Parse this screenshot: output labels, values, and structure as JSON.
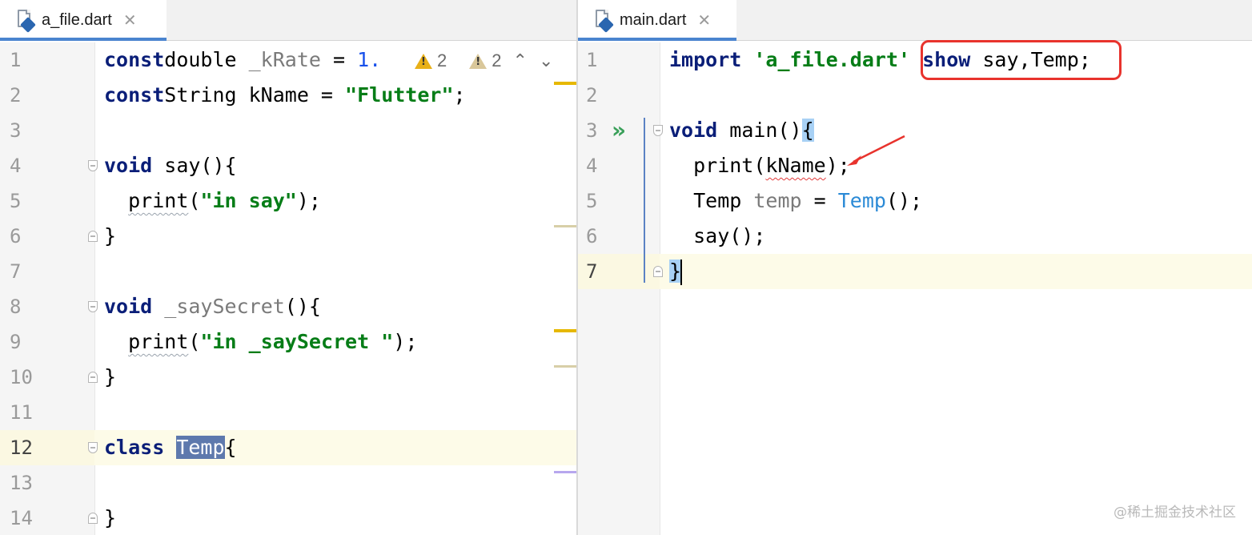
{
  "left_pane": {
    "tab_label": "a_file.dart",
    "tab_close": "✕",
    "lines": [
      {
        "n": "1",
        "t": [
          [
            "kw",
            "const"
          ],
          [
            "",
            "double "
          ],
          [
            "gray",
            "_kRate"
          ],
          [
            "",
            " = "
          ],
          [
            "num",
            "1."
          ]
        ]
      },
      {
        "n": "2",
        "t": [
          [
            "kw",
            "const"
          ],
          [
            "",
            "String kName = "
          ],
          [
            "str",
            "\"Flutter\""
          ],
          [
            "",
            ";"
          ]
        ]
      },
      {
        "n": "3",
        "t": []
      },
      {
        "n": "4",
        "t": [
          [
            "kw",
            "void"
          ],
          [
            "",
            " say(){"
          ]
        ]
      },
      {
        "n": "5",
        "t": [
          [
            "",
            "  "
          ],
          [
            "squig",
            "print"
          ],
          [
            "",
            "("
          ],
          [
            "str",
            "\"in say\""
          ],
          [
            "",
            ");"
          ]
        ]
      },
      {
        "n": "6",
        "t": [
          [
            "",
            "}"
          ]
        ]
      },
      {
        "n": "7",
        "t": []
      },
      {
        "n": "8",
        "t": [
          [
            "kw",
            "void"
          ],
          [
            "",
            " "
          ],
          [
            "gray",
            "_saySecret"
          ],
          [
            "",
            "(){"
          ]
        ]
      },
      {
        "n": "9",
        "t": [
          [
            "",
            "  "
          ],
          [
            "squig",
            "print"
          ],
          [
            "",
            "("
          ],
          [
            "str",
            "\"in _saySecret \""
          ],
          [
            "",
            ");"
          ]
        ]
      },
      {
        "n": "10",
        "t": [
          [
            "",
            "}"
          ]
        ]
      },
      {
        "n": "11",
        "t": []
      },
      {
        "n": "12",
        "t": [
          [
            "kw",
            "class"
          ],
          [
            "",
            " "
          ],
          [
            "hl",
            "Temp"
          ],
          [
            "",
            "{"
          ]
        ]
      },
      {
        "n": "13",
        "t": []
      },
      {
        "n": "14",
        "t": [
          [
            "",
            "}"
          ]
        ]
      }
    ],
    "inspection": {
      "warning_count": "2",
      "weak_warning_count": "2",
      "warning_glyph": "!",
      "up_chevron": "⌃",
      "down_chevron": "⌄"
    }
  },
  "right_pane": {
    "tab_label": "main.dart",
    "tab_close": "✕",
    "lines": [
      {
        "n": "1",
        "t": [
          [
            "kw",
            "import"
          ],
          [
            "",
            " "
          ],
          [
            "str",
            "'a_file.dart'"
          ],
          [
            "",
            " "
          ],
          [
            "kw",
            "show"
          ],
          [
            "",
            " say,Temp;"
          ]
        ]
      },
      {
        "n": "2",
        "t": []
      },
      {
        "n": "3",
        "t": [
          [
            "kw",
            "void"
          ],
          [
            "",
            " main()"
          ],
          [
            "brace-hl",
            "{"
          ]
        ]
      },
      {
        "n": "4",
        "t": [
          [
            "",
            "  print("
          ],
          [
            "squig-red",
            "kName"
          ],
          [
            "",
            ");"
          ]
        ]
      },
      {
        "n": "5",
        "t": [
          [
            "",
            "  Temp "
          ],
          [
            "gray",
            "temp"
          ],
          [
            "",
            " = "
          ],
          [
            "cls",
            "Temp"
          ],
          [
            "",
            "();"
          ]
        ]
      },
      {
        "n": "6",
        "t": [
          [
            "",
            "  say();"
          ]
        ]
      },
      {
        "n": "7",
        "t": [
          [
            "brace-hl",
            "}"
          ]
        ]
      }
    ],
    "run_icon": "»"
  },
  "watermark": "@稀土掘金技术社区",
  "colors": {
    "keyword": "#0a1e78",
    "string": "#067d17",
    "number": "#1750eb",
    "annotation_red": "#e8332d"
  }
}
